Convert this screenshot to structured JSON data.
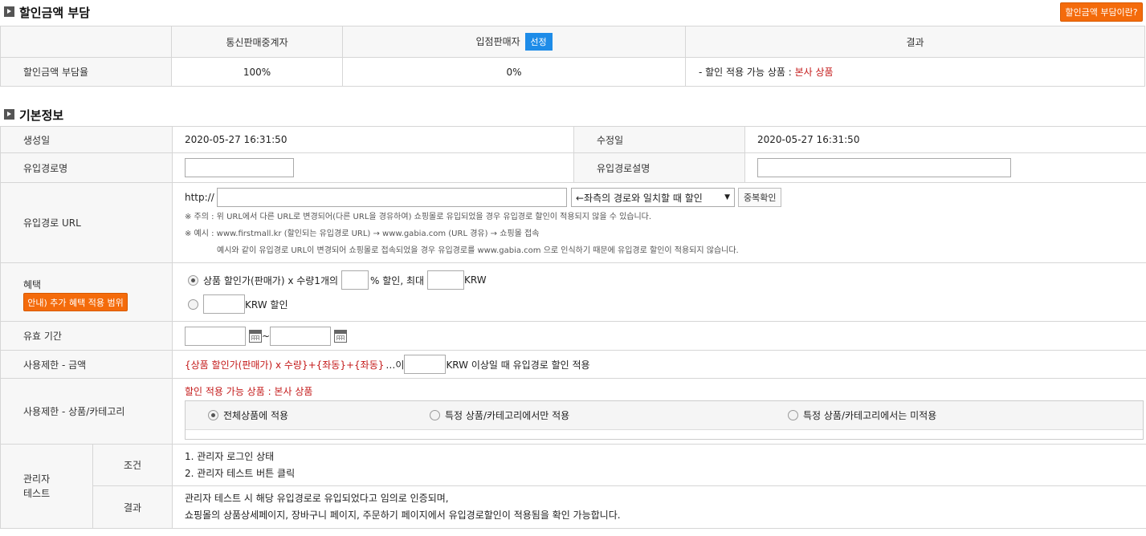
{
  "discount": {
    "title": "할인금액 부담",
    "help_button": "할인금액 부담이란?",
    "headers": {
      "col1": "통신판매중계자",
      "col2": "입점판매자",
      "col2_button": "선정",
      "col3": "결과"
    },
    "row_label": "할인금액 부담율",
    "rate_intermediary": "100%",
    "rate_seller": "0%",
    "result_prefix": "- 할인 적용 가능 상품 : ",
    "result_value": "본사 상품"
  },
  "basic": {
    "title": "기본정보",
    "created_label": "생성일",
    "created_value": "2020-05-27 16:31:50",
    "modified_label": "수정일",
    "modified_value": "2020-05-27 16:31:50",
    "route_name_label": "유입경로명",
    "route_desc_label": "유입경로설명",
    "route_url_label": "유입경로 URL",
    "url_prefix": "http://",
    "url_match_option": "←좌측의 경로와 일치할 때 할인",
    "dup_check_button": "중복확인",
    "note1": "※ 주의 : 위 URL에서 다른 URL로 변경되어(다른 URL을 경유하여) 쇼핑몰로 유입되었을 경우 유입경로 할인이 적용되지 않을 수 있습니다.",
    "note2": "※ 예시 : www.firstmall.kr (할인되는 유입경로 URL) → www.gabia.com (URL 경유) → 쇼핑몰 접속",
    "note3": "예시와 같이 유입경로 URL이 변경되어 쇼핑몰로 접속되었을 경우 유입경로를 www.gabia.com 으로 인식하기 때문에 유입경로 할인이 적용되지 않습니다.",
    "benefit_label": "혜택",
    "benefit_guide_button": "안내) 추가 혜택 적용 범위",
    "benefit_opt1_a": "상품 할인가(판매가) x 수량1개의",
    "benefit_opt1_b": "% 할인, 최대",
    "benefit_opt1_c": "KRW",
    "benefit_opt2": "KRW 할인",
    "period_label": "유효 기간",
    "period_sep": "~",
    "limit_amount_label": "사용제한 - 금액",
    "limit_amount_formula": "{상품 할인가(판매가) x 수량}+{좌동}+{좌동}",
    "limit_amount_mid": "…이",
    "limit_amount_suffix": "KRW 이상일 때 유입경로 할인 적용",
    "limit_cat_label": "사용제한 - 상품/카테고리",
    "limit_cat_notice": "할인 적용 가능 상품 : 본사 상품",
    "limit_cat_opt1": "전체상품에 적용",
    "limit_cat_opt2": "특정 상품/카테고리에서만 적용",
    "limit_cat_opt3": "특정 상품/카테고리에서는 미적용",
    "admin_test_label_1": "관리자",
    "admin_test_label_2": "테스트",
    "cond_label": "조건",
    "cond_line1": "1. 관리자 로그인 상태",
    "cond_line2": "2. 관리자 테스트 버튼 클릭",
    "result_label": "결과",
    "result_line1": "관리자 테스트 시 해당 유입경로로 유입되었다고 임의로 인증되며,",
    "result_line2": "쇼핑몰의 상품상세페이지, 장바구니 페이지, 주문하기 페이지에서 유입경로할인이 적용됨을 확인 가능합니다."
  },
  "colors": {
    "accent_orange": "#f46b0b",
    "accent_blue": "#1e8ce8",
    "notice_red": "#c41a1a"
  }
}
